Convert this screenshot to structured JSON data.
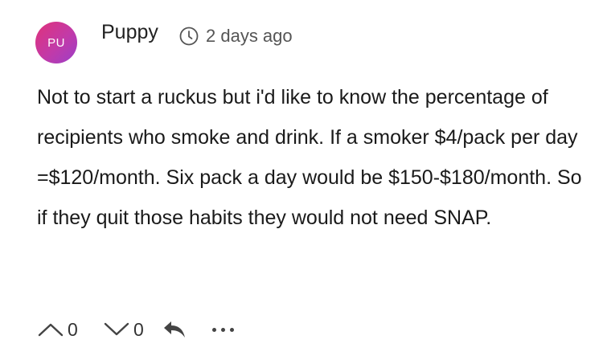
{
  "comment": {
    "avatar_initials": "PU",
    "username": "Puppy",
    "timestamp": "2 days ago",
    "body": "Not to start a ruckus but i'd like to know the percentage of recipients who smoke and drink. If a smoker $4/pack per day =$120/month. Six pack a day would be $150-$180/month. So if they quit those habits they would not need SNAP.",
    "upvotes": "0",
    "downvotes": "0"
  },
  "icons": {
    "clock": "clock-icon",
    "upvote": "chevron-up-icon",
    "downvote": "chevron-down-icon",
    "reply": "reply-arrow-icon",
    "more": "more-horizontal-icon"
  },
  "colors": {
    "avatar_gradient_start": "#e0327a",
    "avatar_gradient_end": "#9b3fc8",
    "text": "#1a1a1a",
    "meta": "#555555"
  }
}
